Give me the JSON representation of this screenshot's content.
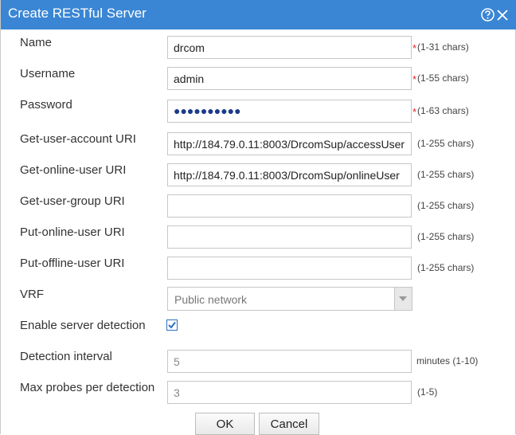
{
  "dialog": {
    "title": "Create RESTful Server"
  },
  "fields": {
    "name": {
      "label": "Name",
      "value": "drcom",
      "hint": "(1-31 chars)",
      "required": "*"
    },
    "username": {
      "label": "Username",
      "value": "admin",
      "hint": "(1-55 chars)",
      "required": "*"
    },
    "password": {
      "label": "Password",
      "value": "●●●●●●●●●●",
      "hint": "(1-63 chars)",
      "required": "*"
    },
    "get_user_account_uri": {
      "label": "Get-user-account URI",
      "value": "http://184.79.0.11:8003/DrcomSup/accessUser",
      "hint": "(1-255 chars)"
    },
    "get_online_user_uri": {
      "label": "Get-online-user URI",
      "value": "http://184.79.0.11:8003/DrcomSup/onlineUser",
      "hint": "(1-255 chars)"
    },
    "get_user_group_uri": {
      "label": "Get-user-group URI",
      "value": "",
      "hint": "(1-255 chars)"
    },
    "put_online_user_uri": {
      "label": "Put-online-user URI",
      "value": "",
      "hint": "(1-255 chars)"
    },
    "put_offline_user_uri": {
      "label": "Put-offline-user URI",
      "value": "",
      "hint": "(1-255 chars)"
    },
    "vrf": {
      "label": "VRF",
      "value": "Public network"
    },
    "enable_server_detection": {
      "label": "Enable server detection",
      "checked": true
    },
    "detection_interval": {
      "label": "Detection interval",
      "value": "5",
      "hint": "minutes (1-10)"
    },
    "max_probes": {
      "label": "Max probes per detection",
      "value": "3",
      "hint": "(1-5)"
    }
  },
  "buttons": {
    "ok": "OK",
    "cancel": "Cancel"
  },
  "colors": {
    "titlebar": "#3a86d4",
    "required": "#e02020",
    "checkbox": "#2d6fc0"
  },
  "icons": {
    "help": "help-icon",
    "close": "close-icon",
    "check": "checkmark-icon",
    "dropdown": "chevron-down-icon"
  }
}
